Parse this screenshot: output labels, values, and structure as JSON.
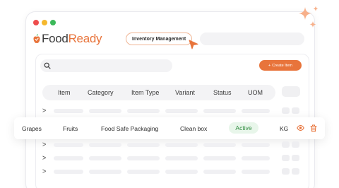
{
  "app": {
    "brand_prefix": "Food",
    "brand_suffix": "Ready"
  },
  "window_controls": {
    "colors": [
      "#ee4d4d",
      "#f5b82e",
      "#3cb95a"
    ]
  },
  "nav": {
    "breadcrumb": "Inventory Management"
  },
  "toolbar": {
    "create_label": "Create Item",
    "create_icon": "plus-icon",
    "search_icon": "search-icon"
  },
  "table": {
    "columns": [
      "Item",
      "Category",
      "Item Type",
      "Variant",
      "Status",
      "UOM"
    ],
    "highlighted_row": {
      "item": "Grapes",
      "category": "Fruits",
      "item_type": "Food Safe Packaging",
      "variant": "Clean box",
      "status": "Active",
      "uom": "KG"
    },
    "row_actions": [
      "eye-icon",
      "trash-icon"
    ]
  },
  "colors": {
    "accent": "#e8743b",
    "status_active_bg": "#e8f6ea",
    "status_active_text": "#2e8b3e"
  }
}
